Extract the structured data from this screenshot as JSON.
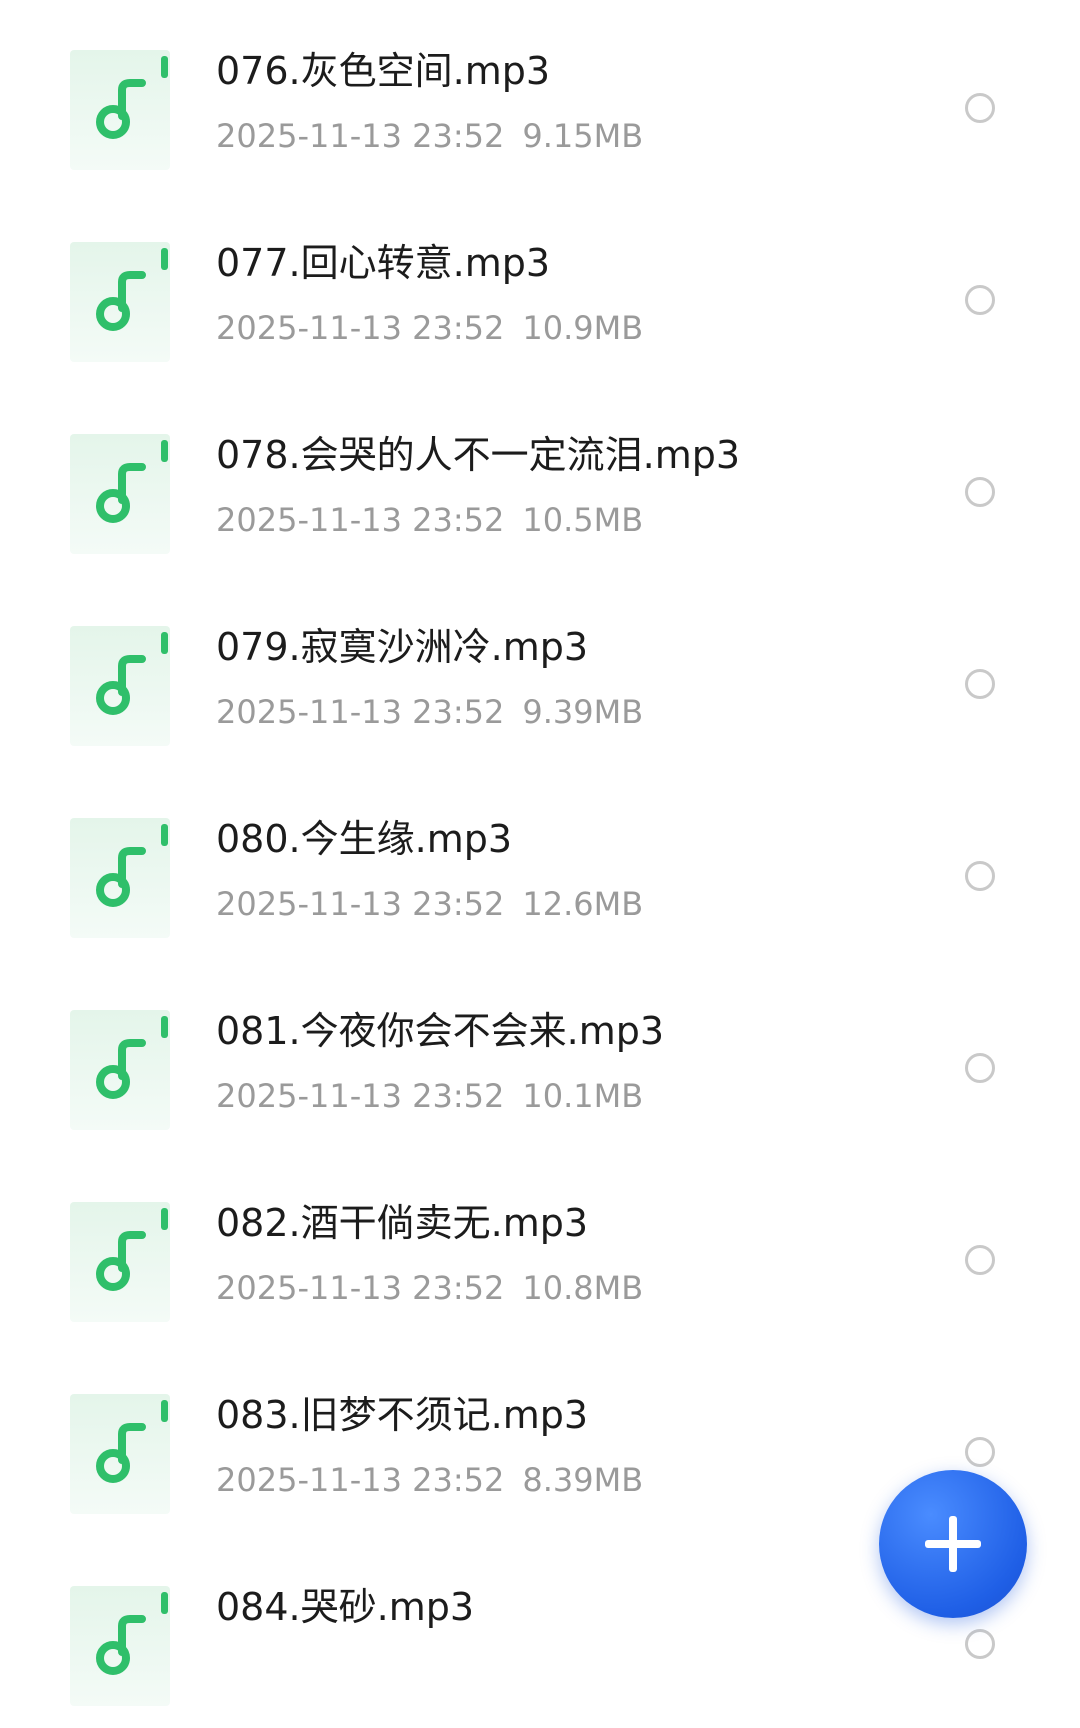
{
  "colors": {
    "icon_bg_top": "#e6f6ec",
    "icon_bg_bottom": "#f3fbf6",
    "icon_accent": "#2fbf6a",
    "name_text": "#1c1c1c",
    "meta_text": "#9a9a9a",
    "radio_border": "#c9c9c9",
    "fab_blue": "#2563eb"
  },
  "icons": {
    "file": "music-note-icon",
    "select": "radio-unchecked-icon",
    "fab": "plus-icon"
  },
  "files": [
    {
      "name": "076.灰色空间.mp3",
      "date": "2025-11-13 23:52",
      "size": "9.15MB"
    },
    {
      "name": "077.回心转意.mp3",
      "date": "2025-11-13 23:52",
      "size": "10.9MB"
    },
    {
      "name": "078.会哭的人不一定流泪.mp3",
      "date": "2025-11-13 23:52",
      "size": "10.5MB"
    },
    {
      "name": "079.寂寞沙洲冷.mp3",
      "date": "2025-11-13 23:52",
      "size": "9.39MB"
    },
    {
      "name": "080.今生缘.mp3",
      "date": "2025-11-13 23:52",
      "size": "12.6MB"
    },
    {
      "name": "081.今夜你会不会来.mp3",
      "date": "2025-11-13 23:52",
      "size": "10.1MB"
    },
    {
      "name": "082.酒干倘卖无.mp3",
      "date": "2025-11-13 23:52",
      "size": "10.8MB"
    },
    {
      "name": "083.旧梦不须记.mp3",
      "date": "2025-11-13 23:52",
      "size": "8.39MB"
    },
    {
      "name": "084.哭砂.mp3",
      "date": "",
      "size": ""
    }
  ]
}
